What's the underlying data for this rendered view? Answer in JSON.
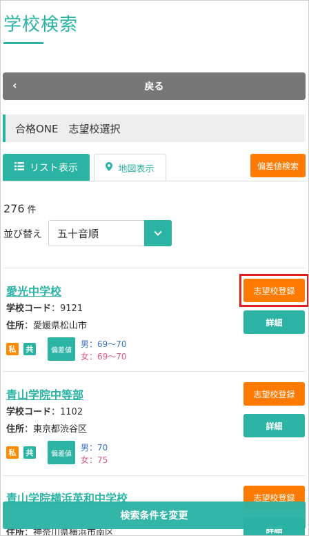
{
  "header": {
    "title": "学校検索"
  },
  "nav": {
    "back_label": "戻る"
  },
  "section": {
    "title": "合格ONE　志望校選択"
  },
  "tabs": [
    {
      "label": "リスト表示",
      "icon": "list-icon",
      "active": true
    },
    {
      "label": "地図表示",
      "icon": "map-pin-icon",
      "active": false
    }
  ],
  "hensachi_search_label": "偏差値検索",
  "results": {
    "count": "276",
    "unit": "件"
  },
  "sort": {
    "label": "並び替え",
    "selected": "五十音順"
  },
  "schools": [
    {
      "name": "愛光中学校",
      "code_label": "学校コード",
      "code": "：9121",
      "address_label": "住所",
      "address": "：愛媛県松山市",
      "badges": [
        "私",
        "共"
      ],
      "hensachi_label": "偏差値",
      "male": "男：69〜70",
      "female": "女：69〜70",
      "register_label": "志望校登録",
      "detail_label": "詳細"
    },
    {
      "name": "青山学院中等部",
      "code_label": "学校コード",
      "code": "：1102",
      "address_label": "住所",
      "address": "：東京都渋谷区",
      "badges": [
        "私",
        "共"
      ],
      "hensachi_label": "偏差値",
      "male": "男：70",
      "female": "女：75",
      "register_label": "志望校登録",
      "detail_label": "詳細"
    },
    {
      "name": "青山学院横浜英和中学校",
      "address_label": "住所",
      "address": "：神奈川県横浜市南区",
      "register_label": "志望校登録",
      "detail_label": "詳細"
    }
  ],
  "bottom_bar": {
    "label": "検索条件を変更"
  },
  "colors": {
    "accent": "#2bb3a4",
    "orange": "#ff7a00",
    "highlight": "#e0201e",
    "back": "#777777"
  }
}
